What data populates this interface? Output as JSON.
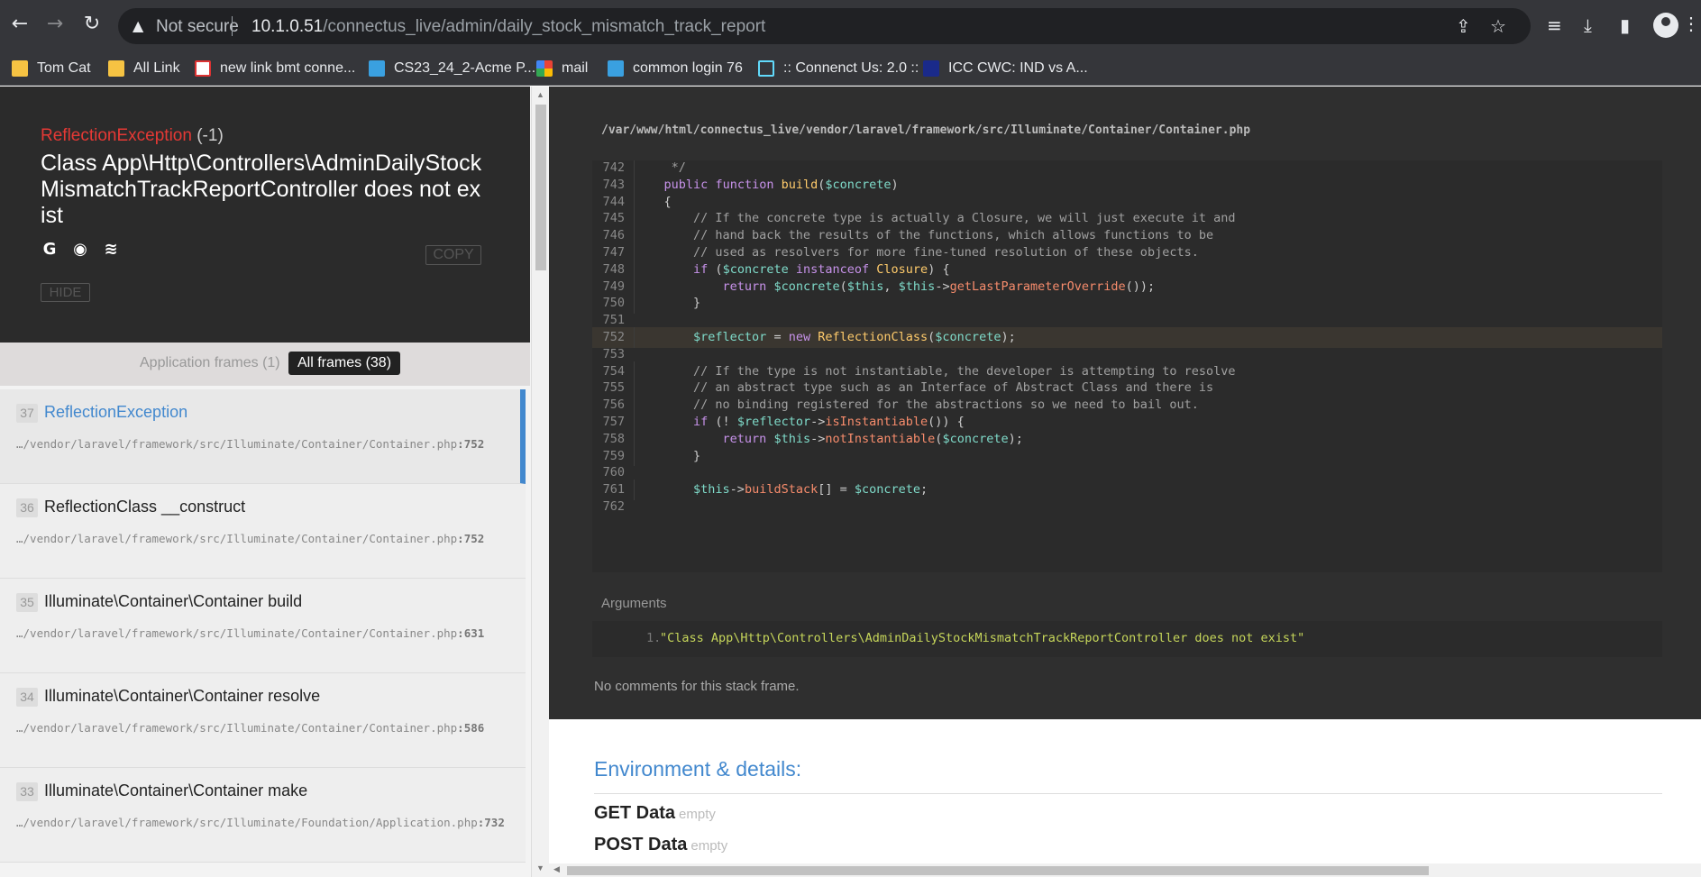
{
  "browser": {
    "security_label": "Not secure",
    "url_host": "10.1.0.51",
    "url_path": "/connectus_live/admin/daily_stock_mismatch_track_report",
    "bookmarks": [
      {
        "label": "Tom Cat",
        "icon": "folder-icon"
      },
      {
        "label": "All Link",
        "icon": "folder-icon"
      },
      {
        "label": "new link bmt conne...",
        "icon": "site-icon"
      },
      {
        "label": "CS23_24_2-Acme P...",
        "icon": "network-icon"
      },
      {
        "label": "mail",
        "icon": "google-icon"
      },
      {
        "label": "common login 76",
        "icon": "network-icon"
      },
      {
        "label": ":: Connenct Us: 2.0 ::",
        "icon": "react-icon"
      },
      {
        "label": "ICC CWC: IND vs A...",
        "icon": "dh-icon"
      }
    ]
  },
  "exception": {
    "class": "ReflectionException",
    "code": "(-1)",
    "message": "Class App\\Http\\Controllers\\AdminDailyStockMismatchTrackReportController does not exist",
    "copy_label": "COPY",
    "hide_label": "HIDE"
  },
  "filters": {
    "application": "Application frames (1)",
    "all": "All frames (38)"
  },
  "frames": [
    {
      "index": "37",
      "title": "ReflectionException",
      "file": "…/vendor/laravel/framework/src/Illuminate/Container/Container.php",
      "line": ":752"
    },
    {
      "index": "36",
      "title": "ReflectionClass __construct",
      "file": "…/vendor/laravel/framework/src/Illuminate/Container/Container.php",
      "line": ":752"
    },
    {
      "index": "35",
      "title": "Illuminate\\Container\\Container build",
      "file": "…/vendor/laravel/framework/src/Illuminate/Container/Container.php",
      "line": ":631"
    },
    {
      "index": "34",
      "title": "Illuminate\\Container\\Container resolve",
      "file": "…/vendor/laravel/framework/src/Illuminate/Container/Container.php",
      "line": ":586"
    },
    {
      "index": "33",
      "title": "Illuminate\\Container\\Container make",
      "file": "…/vendor/laravel/framework/src/Illuminate/Foundation/Application.php",
      "line": ":732"
    }
  ],
  "code": {
    "file_path": "/var/www/html/connectus_live/vendor/laravel/framework/src/Illuminate/Container/Container.php",
    "highlighted_line": "752",
    "lines": [
      {
        "n": "742",
        "t": "     */"
      },
      {
        "n": "743",
        "t": "    public function build($concrete)"
      },
      {
        "n": "744",
        "t": "    {"
      },
      {
        "n": "745",
        "t": "        // If the concrete type is actually a Closure, we will just execute it and"
      },
      {
        "n": "746",
        "t": "        // hand back the results of the functions, which allows functions to be"
      },
      {
        "n": "747",
        "t": "        // used as resolvers for more fine-tuned resolution of these objects."
      },
      {
        "n": "748",
        "t": "        if ($concrete instanceof Closure) {"
      },
      {
        "n": "749",
        "t": "            return $concrete($this, $this->getLastParameterOverride());"
      },
      {
        "n": "750",
        "t": "        }"
      },
      {
        "n": "751",
        "t": ""
      },
      {
        "n": "752",
        "t": "        $reflector = new ReflectionClass($concrete);"
      },
      {
        "n": "753",
        "t": ""
      },
      {
        "n": "754",
        "t": "        // If the type is not instantiable, the developer is attempting to resolve"
      },
      {
        "n": "755",
        "t": "        // an abstract type such as an Interface of Abstract Class and there is"
      },
      {
        "n": "756",
        "t": "        // no binding registered for the abstractions so we need to bail out."
      },
      {
        "n": "757",
        "t": "        if (! $reflector->isInstantiable()) {"
      },
      {
        "n": "758",
        "t": "            return $this->notInstantiable($concrete);"
      },
      {
        "n": "759",
        "t": "        }"
      },
      {
        "n": "760",
        "t": ""
      },
      {
        "n": "761",
        "t": "        $this->buildStack[] = $concrete;"
      },
      {
        "n": "762",
        "t": ""
      }
    ]
  },
  "arguments": {
    "label": "Arguments",
    "items": [
      {
        "n": "1.",
        "value": "\"Class App\\Http\\Controllers\\AdminDailyStockMismatchTrackReportController does not exist\""
      }
    ]
  },
  "comments": "No comments for this stack frame.",
  "environment": {
    "title": "Environment & details:",
    "rows": [
      {
        "label": "GET Data",
        "value": "empty"
      },
      {
        "label": "POST Data",
        "value": "empty"
      }
    ]
  }
}
